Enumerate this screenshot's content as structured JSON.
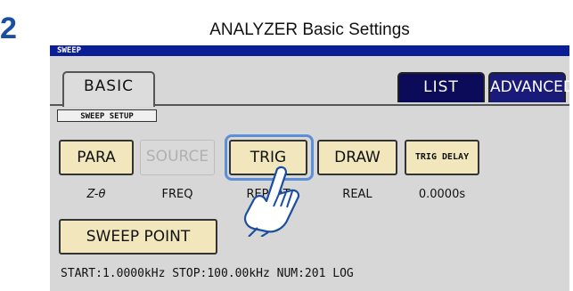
{
  "step_number": "2",
  "title": "ANALYZER Basic Settings",
  "mode": "SWEEP",
  "tabs": {
    "basic": "BASIC",
    "list": "LIST",
    "advanced": "ADVANCED"
  },
  "section_label": "SWEEP SETUP",
  "buttons": {
    "para": {
      "label": "PARA",
      "value": "Z-θ"
    },
    "source": {
      "label": "SOURCE",
      "value": "FREQ"
    },
    "trig": {
      "label": "TRIG",
      "value": "REPEAT"
    },
    "draw": {
      "label": "DRAW",
      "value": "REAL"
    },
    "trig_delay": {
      "label": "TRIG DELAY",
      "value": "0.0000s"
    },
    "sweep_point": {
      "label": "SWEEP POINT"
    }
  },
  "status": "START:1.0000kHz STOP:100.00kHz NUM:201 LOG",
  "colors": {
    "step_number": "#1a4ea0",
    "mode_bar": "#0a1e96",
    "tab_selected_dark": "#0b0b5a",
    "button_fill": "#f2e7bc",
    "highlight": "#5b8fd6"
  },
  "icons": {
    "pointer": "hand-pointer-icon"
  }
}
